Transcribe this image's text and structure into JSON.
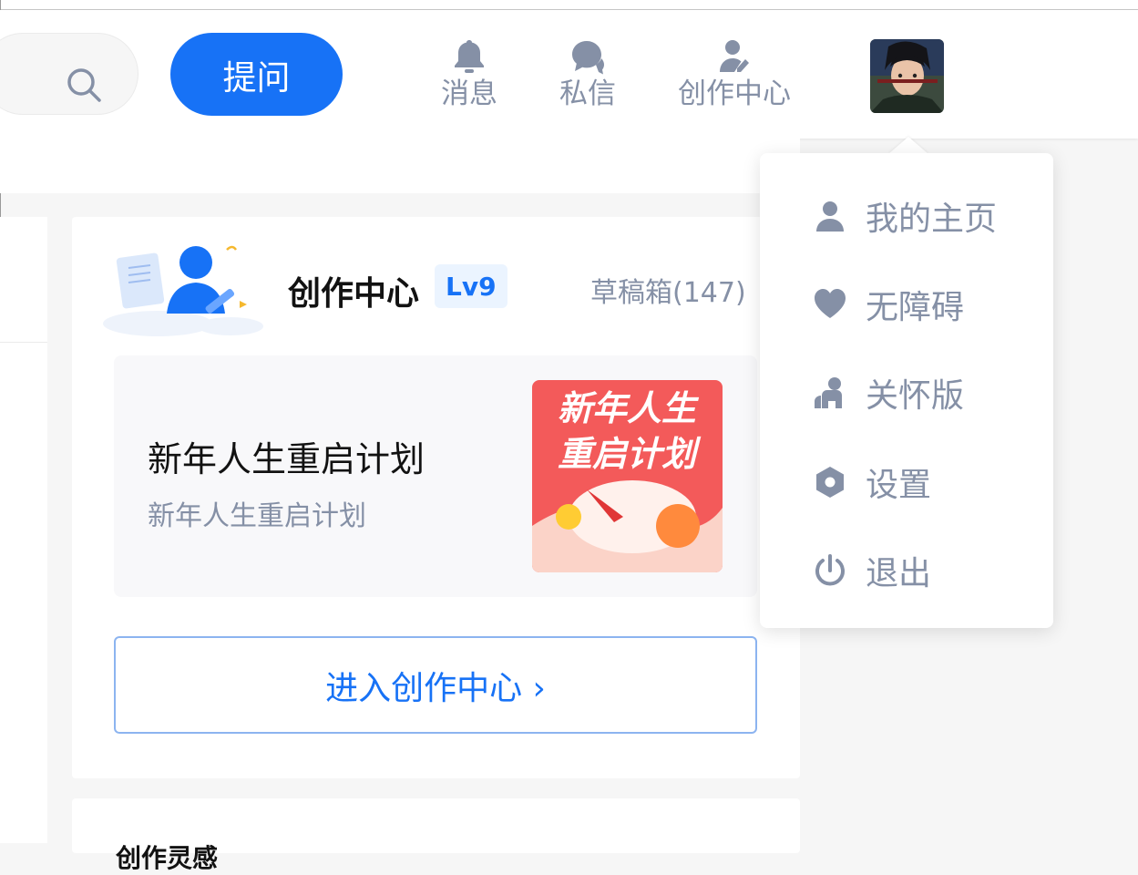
{
  "header": {
    "ask_label": "提问",
    "nav": [
      {
        "label": "消息",
        "icon": "bell-icon"
      },
      {
        "label": "私信",
        "icon": "chat-bubble-icon"
      },
      {
        "label": "创作中心",
        "icon": "creator-icon"
      }
    ]
  },
  "creator_card": {
    "title": "创作中心",
    "level": "Lv9",
    "drafts": "草稿箱(147)",
    "promo": {
      "title": "新年人生重启计划",
      "subtitle": "新年人生重启计划",
      "image_text_line1": "新年人生",
      "image_text_line2": "重启计划"
    },
    "enter_label": "进入创作中心 ›"
  },
  "next_card_peek": "创作灵感",
  "dropdown": {
    "items": [
      {
        "label": "我的主页",
        "icon": "user-icon"
      },
      {
        "label": "无障碍",
        "icon": "heart-icon"
      },
      {
        "label": "关怀版",
        "icon": "care-icon"
      },
      {
        "label": "设置",
        "icon": "settings-hexagon-icon"
      },
      {
        "label": "退出",
        "icon": "power-icon"
      }
    ]
  },
  "colors": {
    "brand": "#1772f6",
    "icon_gray": "#8590a6",
    "text": "#121212"
  }
}
